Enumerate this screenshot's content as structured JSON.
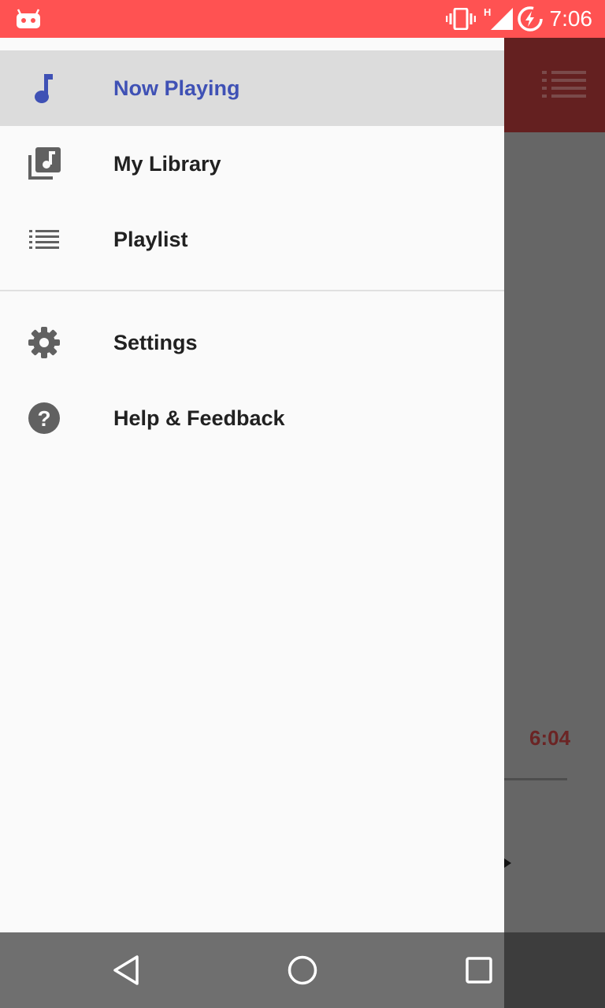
{
  "status_bar": {
    "time": "7:06",
    "network": "H",
    "icons": [
      "android-debug-icon",
      "vibrate-icon",
      "signal-icon",
      "battery-charging-icon"
    ],
    "color": "#ff5252"
  },
  "drawer": {
    "items": [
      {
        "label": "Now Playing",
        "icon": "music-note-icon",
        "active": true
      },
      {
        "label": "My Library",
        "icon": "library-music-icon",
        "active": false
      },
      {
        "label": "Playlist",
        "icon": "list-icon",
        "active": false
      },
      {
        "label": "Settings",
        "icon": "gear-icon",
        "active": false
      },
      {
        "label": "Help & Feedback",
        "icon": "help-icon",
        "active": false
      }
    ],
    "accent_color": "#3f51b5"
  },
  "background_app": {
    "toolbar_icon": "queue-list-icon",
    "duration": "6:04"
  },
  "nav_bar": {
    "buttons": [
      "back-icon",
      "home-icon",
      "recents-icon"
    ]
  }
}
